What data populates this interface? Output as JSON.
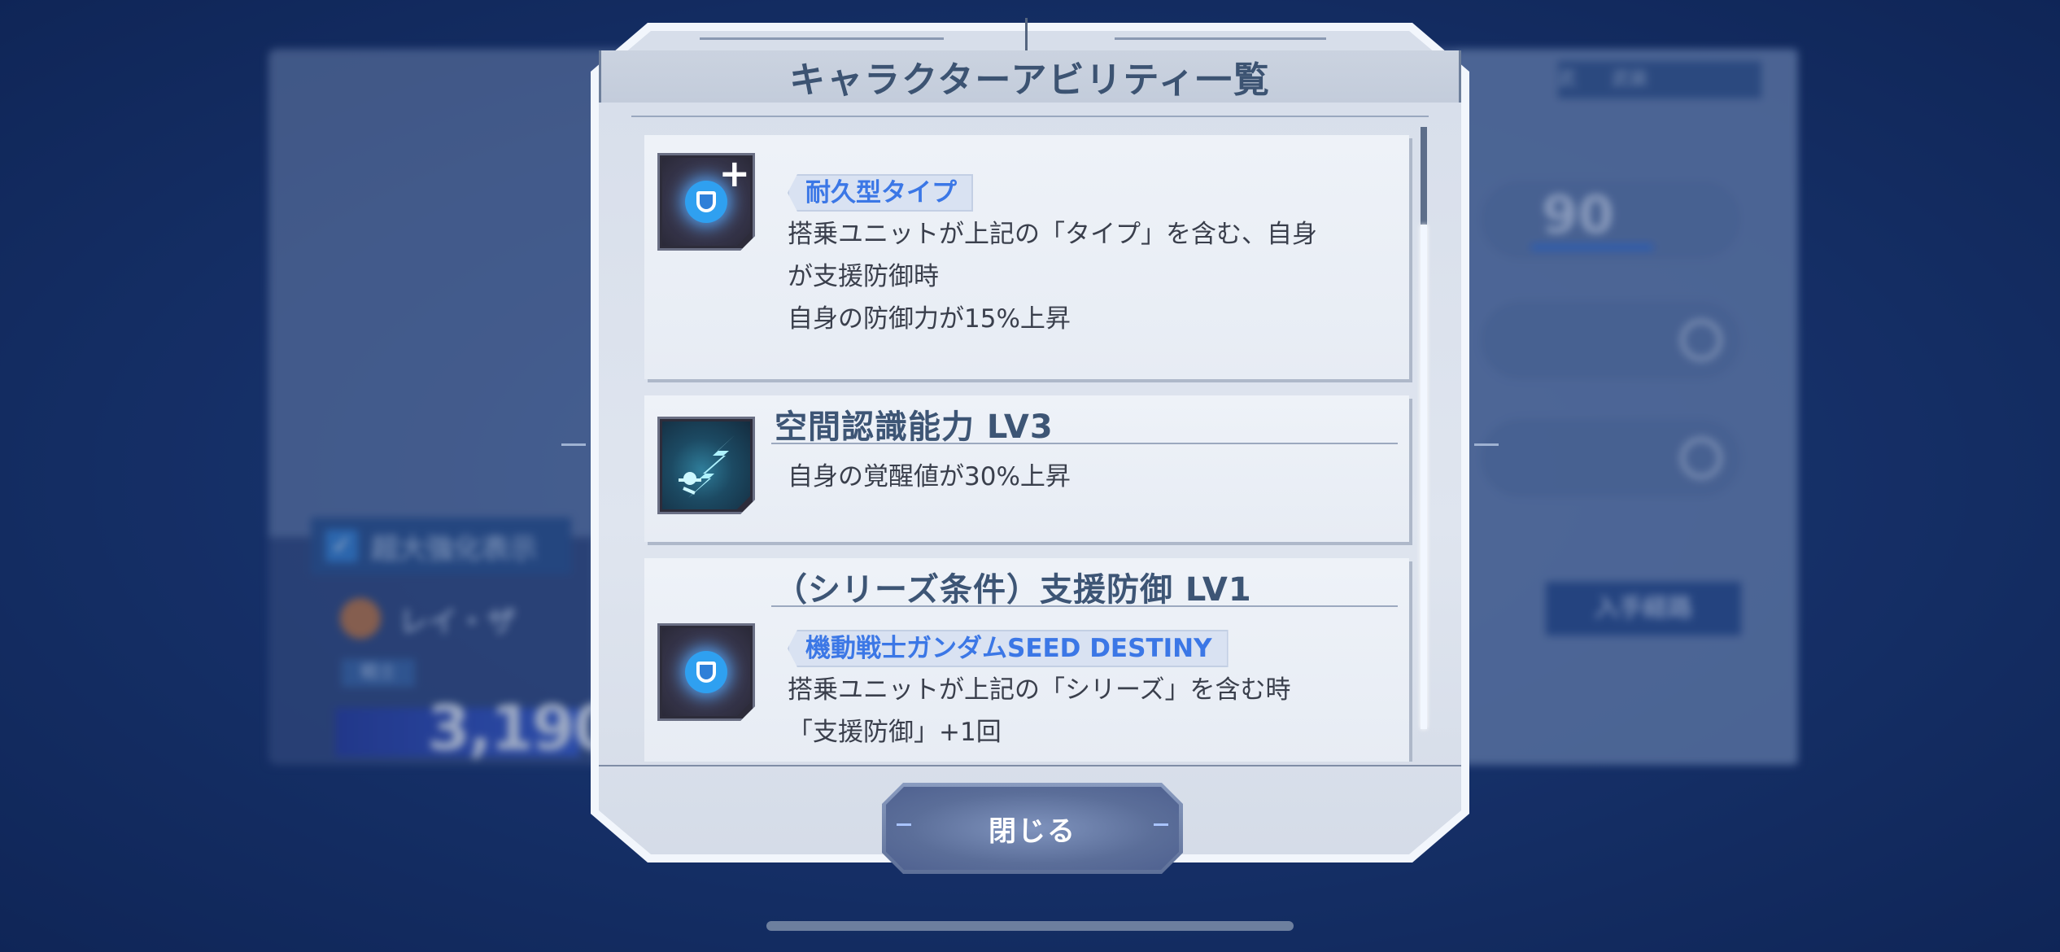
{
  "background": {
    "checkbox_label": "超大強化表示",
    "pilot_name": "レイ・ザ",
    "pilot_tag": "戦士",
    "stat_value": "3,190",
    "level_value": "90",
    "tabs_label": "武　　武装",
    "action_button": "入手経路"
  },
  "modal": {
    "title": "キャラクターアビリティ一覧",
    "close_label": "閉じる"
  },
  "abilities": [
    {
      "icon": "shield-plus-icon",
      "tag": "耐久型タイプ",
      "lines": [
        "搭乗ユニットが上記の「タイプ」を含む、自身",
        "が支援防御時",
        "自身の防御力が15%上昇"
      ]
    },
    {
      "icon": "spatial-awareness-icon",
      "heading": "空間認識能力 LV3",
      "lines": [
        "自身の覚醒値が30%上昇"
      ]
    },
    {
      "icon": "shield-icon",
      "heading": "（シリーズ条件）支援防御 LV1",
      "tag": "機動戦士ガンダムSEED DESTINY",
      "lines": [
        "搭乗ユニットが上記の「シリーズ」を含む時",
        "「支援防御」+1回"
      ]
    }
  ],
  "colors": {
    "accent_blue": "#3b77e6",
    "title_text": "#3c5372",
    "glow": "#2fa0f0"
  }
}
